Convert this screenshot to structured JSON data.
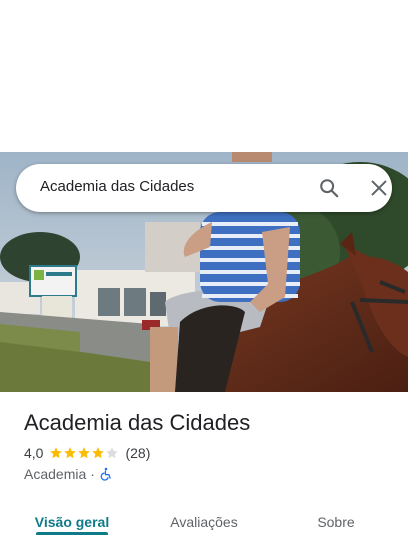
{
  "search": {
    "query": "Academia das Cidades"
  },
  "icons": {
    "search": "search-icon",
    "close": "close-icon",
    "star": "star-icon",
    "accessible": "wheelchair-accessible-icon"
  },
  "place": {
    "name": "Academia das Cidades",
    "rating": "4,0",
    "rating_stars": 4,
    "rating_max": 5,
    "review_count": "(28)",
    "category": "Academia",
    "separator": "·"
  },
  "tabs": [
    {
      "label": "Visão geral",
      "active": true
    },
    {
      "label": "Avaliações",
      "active": false
    },
    {
      "label": "Sobre",
      "active": false
    }
  ],
  "colors": {
    "accent": "#0f7b8a",
    "star_filled": "#fbbc04",
    "star_empty": "#dadce0",
    "accessible_icon": "#1a73e8"
  }
}
